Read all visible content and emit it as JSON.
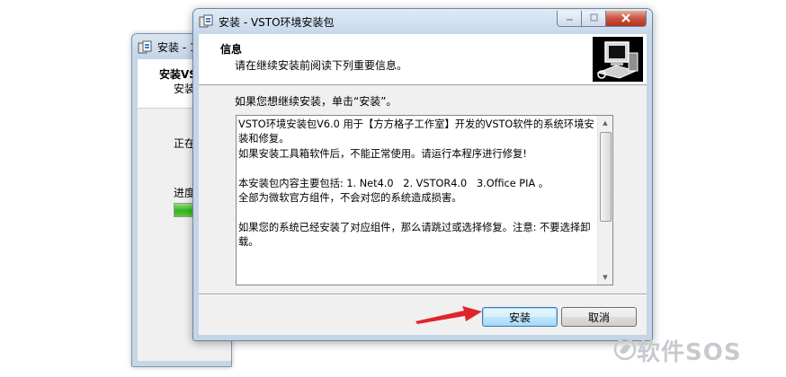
{
  "background_window": {
    "title": "安装 - 1",
    "header_title": "安装VS",
    "header_subtitle": "安装",
    "status_text": "正在",
    "progress_label": "进度",
    "progress_fraction": 0.6
  },
  "dialog": {
    "title": "安装 - VSTO环境安装包",
    "header": {
      "title": "信息",
      "subtitle": "请在继续安装前阅读下列重要信息。"
    },
    "intro": "如果您想继续安装，单击“安装”。",
    "info_text": "VSTO环境安装包V6.0 用于【方方格子工作室】开发的VSTO软件的系统环境安装和修复。\n如果安装工具箱软件后，不能正常使用。请运行本程序进行修复!\n\n本安装包内容主要包括: 1. Net4.0   2. VSTOR4.0   3.Office PIA 。\n全部为微软官方组件，不会对您的系统造成损害。\n\n如果您的系统已经安装了对应组件，那么请跳过或选择修复。注意: 不要选择卸载。",
    "buttons": {
      "install": "安装",
      "cancel": "取消"
    }
  },
  "icons": [
    "app-icon",
    "minimize-icon",
    "maximize-icon",
    "close-icon",
    "wizard-computer-icon",
    "scroll-up-icon",
    "scroll-down-icon"
  ],
  "watermark": "软件SOS",
  "colors": {
    "annotation_arrow": "#e0242b",
    "progress_green": "#33b51d",
    "default_button_border": "#3c7fb1"
  }
}
